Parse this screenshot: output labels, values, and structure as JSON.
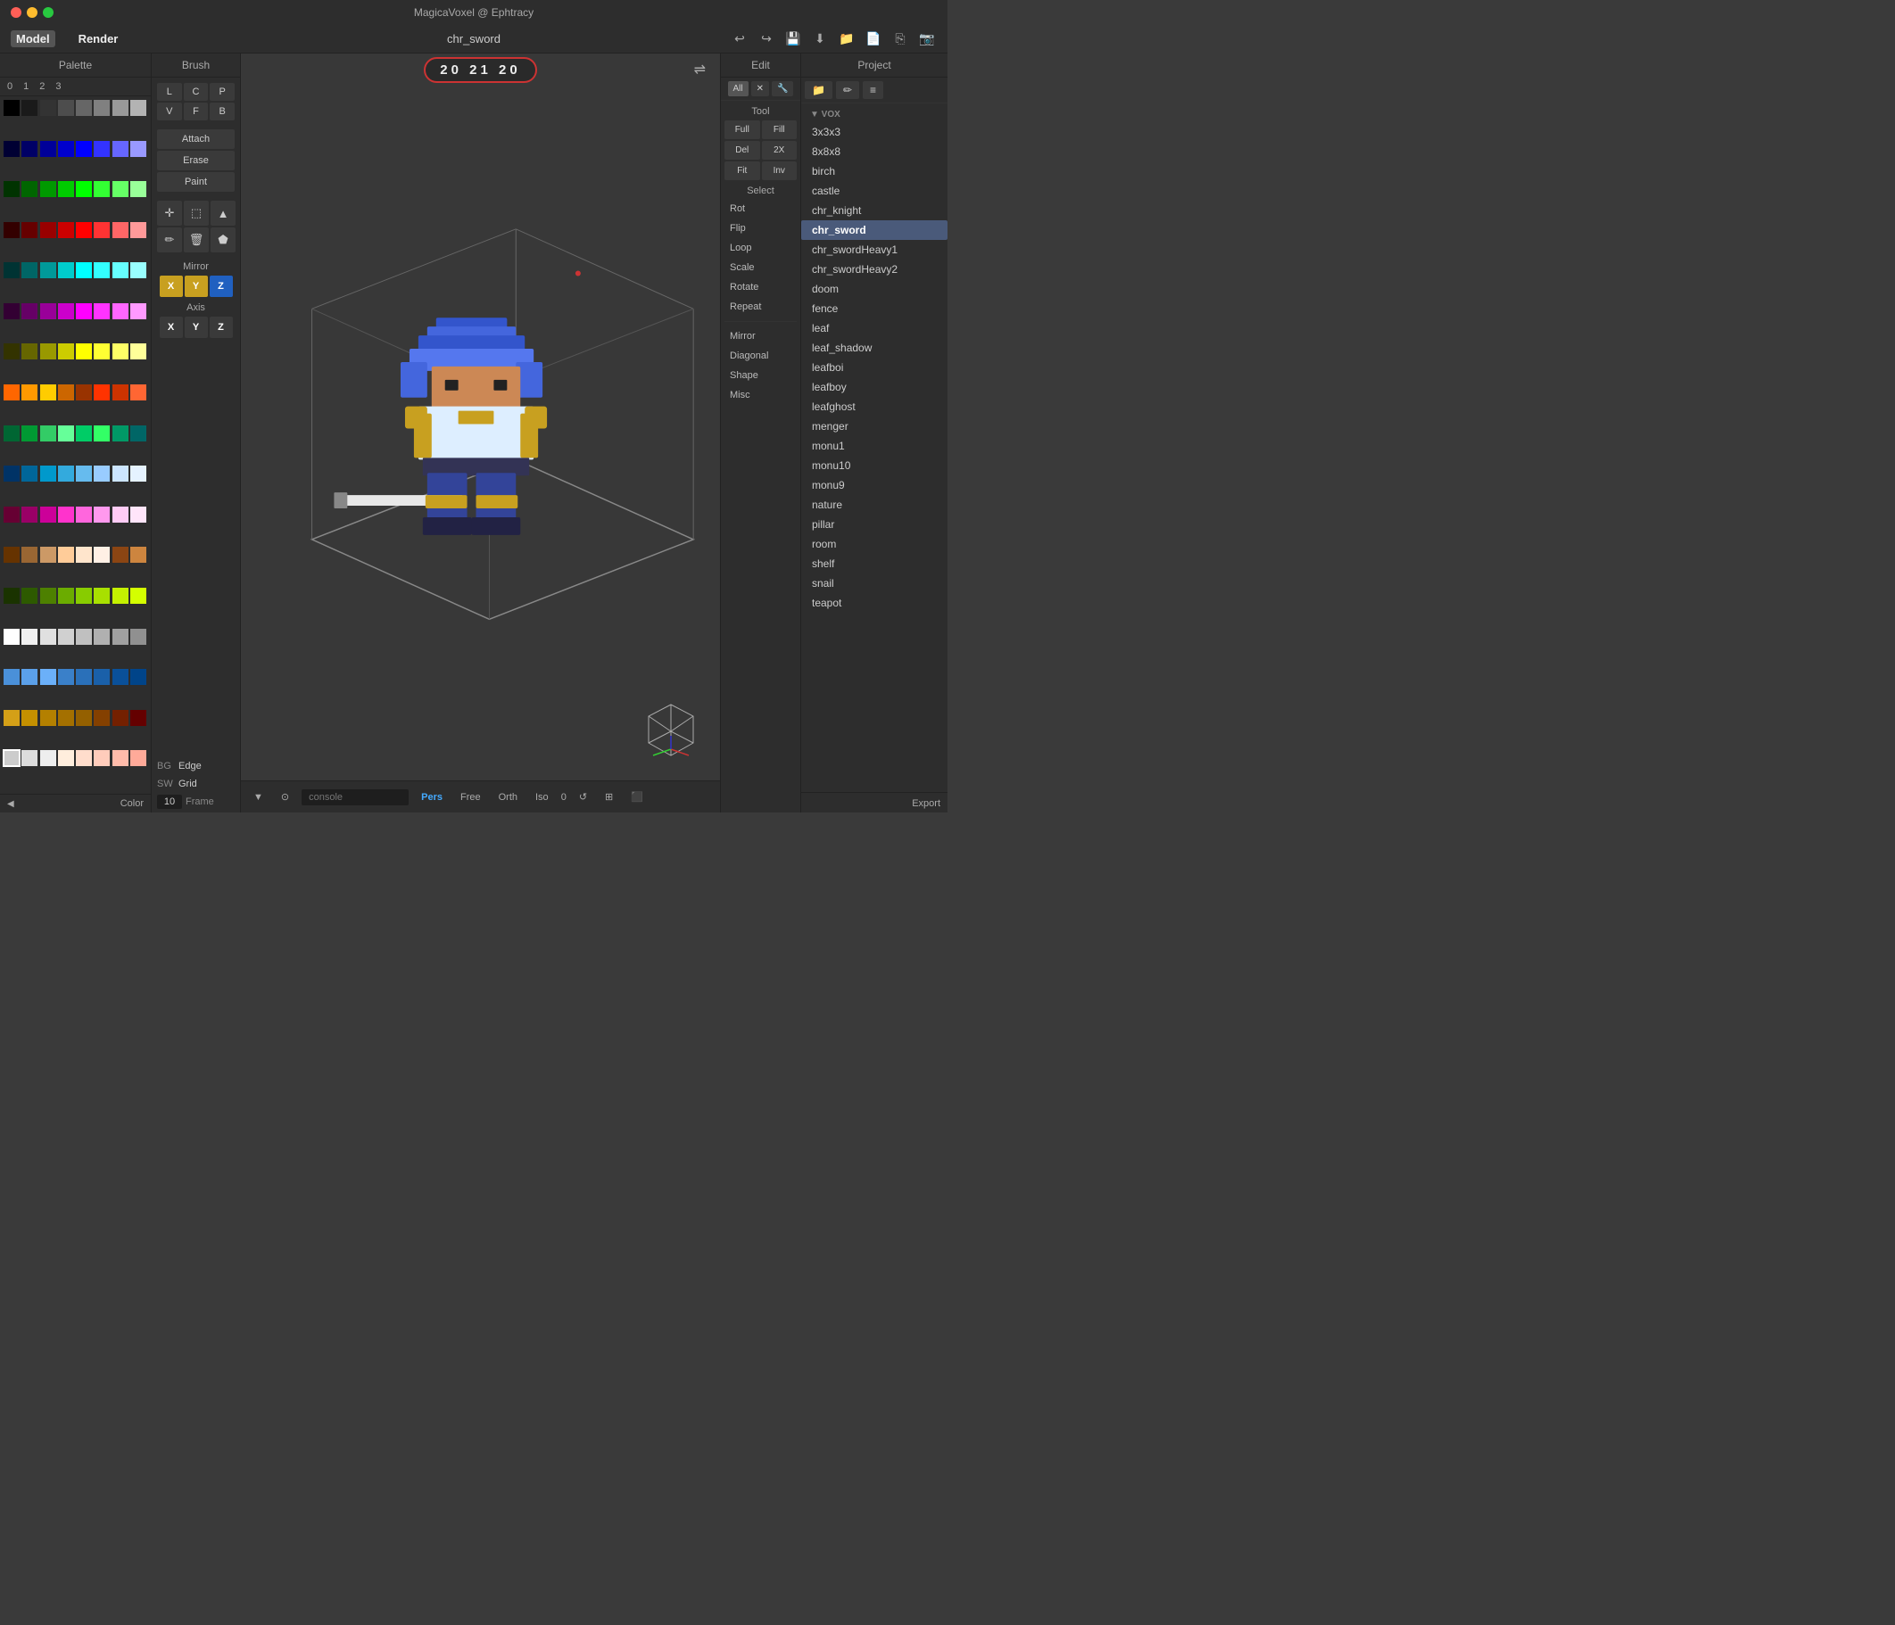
{
  "titleBar": {
    "appTitle": "MagicaVoxel @ Ephtracy"
  },
  "menuBar": {
    "model": "Model",
    "render": "Render",
    "fileName": "chr_sword"
  },
  "toolbar": {
    "undoIcon": "↩",
    "redoIcon": "↪",
    "saveIcon": "💾",
    "downloadIcon": "⬇",
    "folderIcon": "📁",
    "fileIcon": "📄",
    "copyIcon": "⎘",
    "camIcon": "📷"
  },
  "palette": {
    "header": "Palette",
    "tabs": [
      "0",
      "1",
      "2",
      "3"
    ],
    "colorLabel": "Color",
    "expandArrow": "◀"
  },
  "brush": {
    "header": "Brush",
    "modes": [
      "L",
      "C",
      "P",
      "V",
      "F",
      "B"
    ],
    "actions": [
      "Attach",
      "Erase",
      "Paint"
    ],
    "mirror": {
      "label": "Mirror",
      "axes": [
        "X",
        "Y",
        "Z"
      ]
    },
    "axis": {
      "label": "Axis",
      "axes": [
        "X",
        "Y",
        "Z"
      ]
    }
  },
  "dimensions": {
    "x": "20",
    "y": "21",
    "z": "20"
  },
  "viewport": {
    "swapIcon": "⇌"
  },
  "viewportBottom": {
    "dropdownIcon": "▼",
    "cameraIcon": "⊙",
    "consolePlaceholder": "console",
    "pers": "Pers",
    "free": "Free",
    "orth": "Orth",
    "iso": "Iso",
    "number": "0",
    "resetIcon": "↺",
    "gridIcon": "⊞",
    "cubeIcon": "⬛"
  },
  "brushPanel": {
    "bgLabel": "BG",
    "swLabel": "SW",
    "edgeLabel": "Edge",
    "gridLabel": "Grid",
    "frameLabel": "Frame",
    "frameNum": "10"
  },
  "edit": {
    "header": "Edit",
    "filters": [
      "All",
      "✕",
      "🔧"
    ],
    "toolLabel": "Tool",
    "toolBtns": [
      "Full",
      "Fill",
      "Del",
      "2X",
      "Fit",
      "Inv"
    ],
    "selectLabel": "Select",
    "editItems": [
      "Rot",
      "Flip",
      "Loop",
      "Scale",
      "Rotate",
      "Repeat"
    ],
    "mirrorItems": [
      "Mirror",
      "Diagonal",
      "Shape",
      "Misc"
    ]
  },
  "project": {
    "header": "Project",
    "voxLabel": "▼ VOX",
    "items": [
      {
        "name": "3x3x3",
        "active": false
      },
      {
        "name": "8x8x8",
        "active": false
      },
      {
        "name": "birch",
        "active": false
      },
      {
        "name": "castle",
        "active": false
      },
      {
        "name": "chr_knight",
        "active": false
      },
      {
        "name": "chr_sword",
        "active": true
      },
      {
        "name": "chr_swordHeavy1",
        "active": false
      },
      {
        "name": "chr_swordHeavy2",
        "active": false
      },
      {
        "name": "doom",
        "active": false
      },
      {
        "name": "fence",
        "active": false
      },
      {
        "name": "leaf",
        "active": false
      },
      {
        "name": "leaf_shadow",
        "active": false
      },
      {
        "name": "leafboi",
        "active": false
      },
      {
        "name": "leafboy",
        "active": false
      },
      {
        "name": "leafghost",
        "active": false
      },
      {
        "name": "menger",
        "active": false
      },
      {
        "name": "monu1",
        "active": false
      },
      {
        "name": "monu10",
        "active": false
      },
      {
        "name": "monu9",
        "active": false
      },
      {
        "name": "nature",
        "active": false
      },
      {
        "name": "pillar",
        "active": false
      },
      {
        "name": "room",
        "active": false
      },
      {
        "name": "shelf",
        "active": false
      },
      {
        "name": "snail",
        "active": false
      },
      {
        "name": "teapot",
        "active": false
      }
    ],
    "exportLabel": "Export"
  },
  "colors": {
    "palette": [
      "#000000",
      "#1a1a1a",
      "#333333",
      "#4d4d4d",
      "#666666",
      "#808080",
      "#999999",
      "#b3b3b3",
      "#000033",
      "#000066",
      "#000099",
      "#0000cc",
      "#0000ff",
      "#3333ff",
      "#6666ff",
      "#9999ff",
      "#003300",
      "#006600",
      "#009900",
      "#00cc00",
      "#00ff00",
      "#33ff33",
      "#66ff66",
      "#99ff99",
      "#330000",
      "#660000",
      "#990000",
      "#cc0000",
      "#ff0000",
      "#ff3333",
      "#ff6666",
      "#ff9999",
      "#003333",
      "#006666",
      "#009999",
      "#00cccc",
      "#00ffff",
      "#33ffff",
      "#66ffff",
      "#99ffff",
      "#330033",
      "#660066",
      "#990099",
      "#cc00cc",
      "#ff00ff",
      "#ff33ff",
      "#ff66ff",
      "#ff99ff",
      "#333300",
      "#666600",
      "#999900",
      "#cccc00",
      "#ffff00",
      "#ffff33",
      "#ffff66",
      "#ffff99",
      "#ff6600",
      "#ff9900",
      "#ffcc00",
      "#cc6600",
      "#993300",
      "#ff3300",
      "#cc3300",
      "#ff6633",
      "#006633",
      "#009933",
      "#33cc66",
      "#66ff99",
      "#00cc66",
      "#33ff66",
      "#009966",
      "#006666",
      "#003366",
      "#006699",
      "#0099cc",
      "#33aadd",
      "#66bbee",
      "#99ccff",
      "#cce5ff",
      "#e5f2ff",
      "#660033",
      "#990066",
      "#cc0099",
      "#ff33cc",
      "#ff66dd",
      "#ff99ee",
      "#ffccf5",
      "#ffe5fa",
      "#663300",
      "#996633",
      "#cc9966",
      "#ffcc99",
      "#ffe5cc",
      "#fff0e5",
      "#8B4513",
      "#cd853f",
      "#1a3300",
      "#2d5a00",
      "#4d8000",
      "#6bac00",
      "#88cc00",
      "#a8e000",
      "#c4f000",
      "#d4ff00",
      "#ffffff",
      "#f0f0f0",
      "#e0e0e0",
      "#d0d0d0",
      "#c0c0c0",
      "#b0b0b0",
      "#a0a0a0",
      "#909090",
      "#4a90d9",
      "#5ba0e9",
      "#6bb0f9",
      "#3a80c9",
      "#2a70b9",
      "#1a60a9",
      "#0a5099",
      "#004489",
      "#d4a017",
      "#c49000",
      "#b48000",
      "#a47000",
      "#946000",
      "#844000",
      "#742000",
      "#640000",
      "#cccccc",
      "#dddddd",
      "#eeeeee",
      "#ffeedd",
      "#ffddcc",
      "#ffccbb",
      "#ffbbaa",
      "#ffaa99"
    ]
  }
}
